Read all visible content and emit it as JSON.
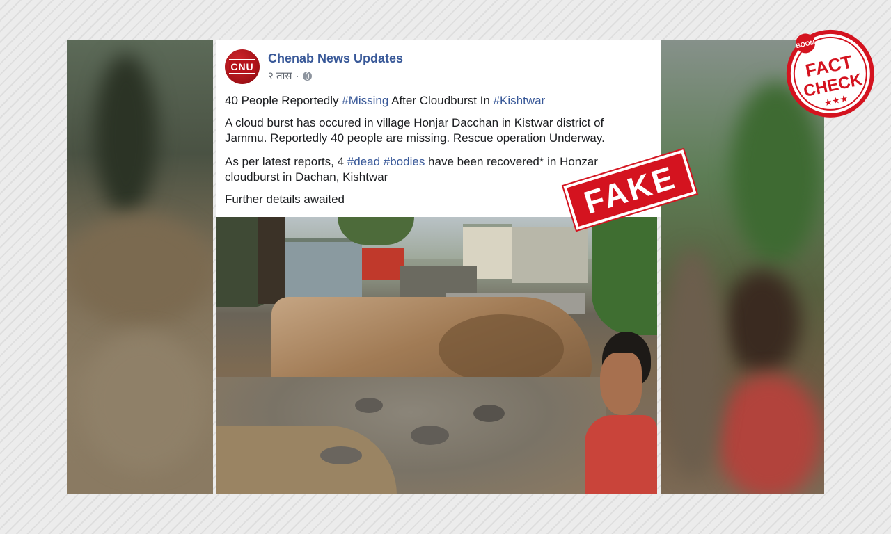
{
  "post": {
    "page_name": "Chenab News Updates",
    "avatar_text": "CNU",
    "time": "२ तास",
    "separator": "·",
    "headline": {
      "part1": "40 People Reportedly ",
      "tag1": "#Missing",
      "part2": " After Cloudburst In ",
      "tag2": "#Kishtwar"
    },
    "paragraph1": {
      "line1": "A cloud burst has occured in village Honjar Dacchan in Kistwar district of",
      "line2": "Jammu. Reportedly 40 people are missing. Rescue operation Underway."
    },
    "paragraph2": {
      "part1": "As per latest reports, 4 ",
      "tag1": "#dead",
      "space": " ",
      "tag2": "#bodies",
      "part2": " have been recovered* in Honzar",
      "line2": "cloudburst in Dachan, Kishtwar"
    },
    "paragraph3": "Further details awaited"
  },
  "stamp": {
    "text": "FAKE",
    "color": "#d4131f"
  },
  "badge": {
    "top_text": "BOOM",
    "line1": "FACT",
    "line2": "CHECK",
    "stars": "★★★",
    "color": "#d4131f"
  },
  "colors": {
    "link": "#385898",
    "text": "#1c1e21",
    "meta": "#616770"
  },
  "icons": {
    "privacy": "globe-icon"
  }
}
